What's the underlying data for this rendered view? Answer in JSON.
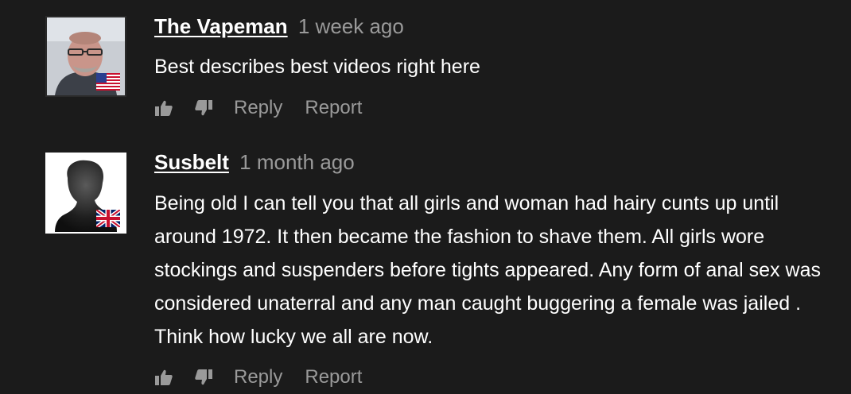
{
  "comments": [
    {
      "username": "The Vapeman",
      "time": "1 week ago",
      "text": "Best describes best videos right here",
      "flag": "us-flag-icon",
      "reply": "Reply",
      "report": "Report"
    },
    {
      "username": "Susbelt",
      "time": "1 month ago",
      "text": "Being old I can tell you that all girls and woman had hairy cunts up until around 1972. It then became the fashion to shave them. All girls wore stockings and suspenders before tights appeared. Any form of anal sex was considered unaterral and any man caught buggering a female was jailed . Think how lucky we all are now.",
      "flag": "uk-flag-icon",
      "reply": "Reply",
      "report": "Report"
    }
  ],
  "icons": {
    "like": "thumbs-up-icon",
    "dislike": "thumbs-down-icon"
  },
  "colors": {
    "background": "#1b1b1b",
    "username": "#ffffff",
    "meta": "#9a9a9a",
    "text": "#ffffff"
  }
}
